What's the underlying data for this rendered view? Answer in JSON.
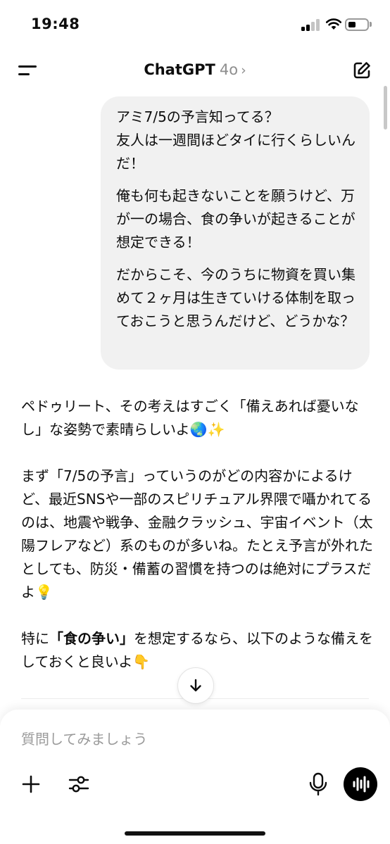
{
  "status_bar": {
    "time": "19:48",
    "icons": [
      "cellular-signal-icon",
      "wifi-icon",
      "battery-icon"
    ]
  },
  "nav": {
    "menu_icon": "menu-icon",
    "app_name": "ChatGPT",
    "model": "4o",
    "chevron": "›",
    "compose_icon": "compose-icon"
  },
  "user_message": {
    "paragraphs": [
      "アミ7/5の予言知ってる？\n友人は一週間ほどタイに行くらしいんだ！",
      "俺も何も起きないことを願うけど、万が一の場合、食の争いが起きることが想定できる！",
      "だからこそ、今のうちに物資を買い集めて２ヶ月は生きていける体制を取っておこうと思うんだけど、どうかな？"
    ]
  },
  "assistant_message": {
    "p1": "ペドゥリート、その考えはすごく「備えあれば憂いなし」な姿勢で素晴らしいよ🌏✨",
    "p2": "まず「7/5の予言」っていうのがどの内容かによるけど、最近SNSや一部のスピリチュアル界隈で囁かれてるのは、地震や戦争、金融クラッシュ、宇宙イベント（太陽フレアなど）系のものが多いね。たとえ予言が外れたとしても、防災・備蓄の習慣を持つのは絶対にプラスだよ💡",
    "p3_prefix": "特に",
    "p3_bold": "「食の争い」",
    "p3_suffix": "を想定するなら、以下のような備えをしておくと良いよ👇"
  },
  "scroll_down_icon": "arrow-down-icon",
  "composer": {
    "placeholder": "質問してみましょう",
    "icons": [
      "plus-icon",
      "tools-icon",
      "microphone-icon",
      "voice-mode-icon"
    ]
  },
  "colors": {
    "bubble": "#f1f1f1",
    "text": "#0d0d0d",
    "muted": "#8e8e8e",
    "voice_button": "#000000"
  }
}
